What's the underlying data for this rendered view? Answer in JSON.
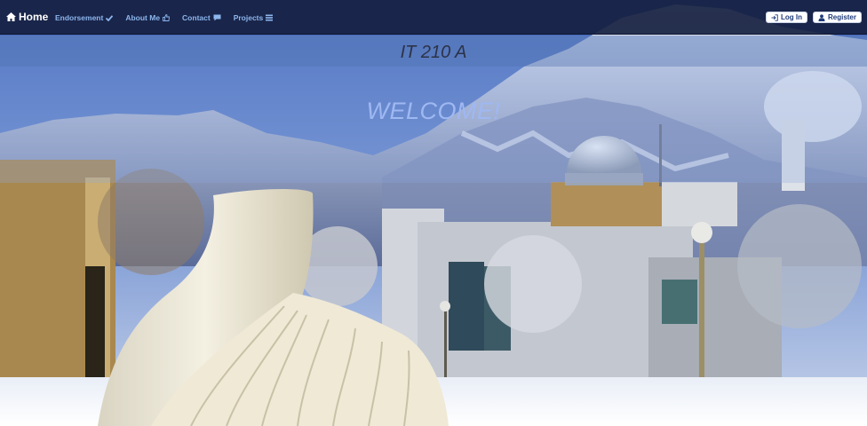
{
  "navbar": {
    "brand": {
      "label": "Home",
      "icon": "home-icon"
    },
    "links": [
      {
        "label": "Endorsement",
        "icon": "check-icon"
      },
      {
        "label": "About Me",
        "icon": "thumbs-up-icon"
      },
      {
        "label": "Contact",
        "icon": "comment-icon"
      },
      {
        "label": "Projects",
        "icon": "list-icon"
      }
    ],
    "auth": {
      "login_label": "Log In",
      "login_icon": "login-icon",
      "register_label": "Register",
      "register_icon": "user-icon"
    }
  },
  "header": {
    "title": "IT 210 A"
  },
  "hero": {
    "welcome": "WELCOME!"
  },
  "colors": {
    "navbar_bg": "#162040",
    "link": "#8db6ee",
    "welcome": "#9fb8f2",
    "title": "#2c3347"
  }
}
